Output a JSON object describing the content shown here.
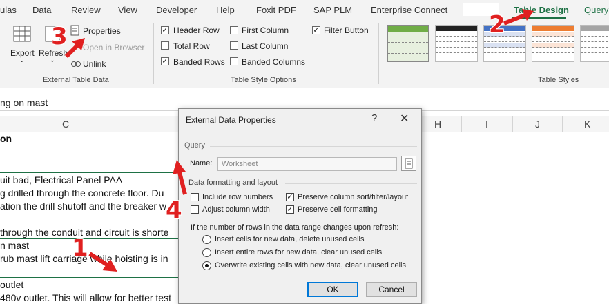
{
  "ribbon_tabs": [
    "ulas",
    "Data",
    "Review",
    "View",
    "Developer",
    "Help",
    "Foxit PDF",
    "SAP PLM",
    "Enterprise Connect",
    "Table Design",
    "Query"
  ],
  "active_tab": "Table Design",
  "external_table_data": {
    "export_label": "Export",
    "refresh_label": "Refresh",
    "properties_label": "Properties",
    "open_in_browser_label": "Open in Browser",
    "unlink_label": "Unlink",
    "group_label": "External Table Data"
  },
  "table_style_options": {
    "header_row": "Header Row",
    "first_column": "First Column",
    "filter_button": "Filter Button",
    "total_row": "Total Row",
    "last_column": "Last Column",
    "banded_rows": "Banded Rows",
    "banded_columns": "Banded Columns",
    "group_label": "Table Style Options",
    "checked": {
      "header_row": true,
      "first_column": false,
      "filter_button": true,
      "total_row": false,
      "last_column": false,
      "banded_rows": true,
      "banded_columns": false
    }
  },
  "table_styles": {
    "group_label": "Table Styles",
    "swatch_colors": [
      "#70ad47",
      "#222222",
      "#4472c4",
      "#ed7d31",
      "#a5a5a5"
    ]
  },
  "formula_bar": {
    "text": "ng on mast"
  },
  "columns": {
    "c": "C",
    "h": "H",
    "i": "I",
    "j": "J",
    "k": "K"
  },
  "sheet_rows": [
    "on",
    "uit bad, Electrical Panel PAA",
    "g drilled through the concrete floor.  Du",
    "ation the drill shutoff and the breaker w",
    "through the conduit and circuit is shorte",
    "n mast",
    "rub mast lift carriage while hoisting is in",
    "outlet",
    "480v outlet. This will allow for better test"
  ],
  "dialog": {
    "title": "External Data Properties",
    "help": "?",
    "close": "✕",
    "query_section": "Query",
    "name_label": "Name:",
    "name_value": "Worksheet",
    "format_section": "Data formatting and layout",
    "include_row_numbers": "Include row numbers",
    "preserve_sort": "Preserve column sort/filter/layout",
    "adjust_column_width": "Adjust column width",
    "preserve_cell_formatting": "Preserve cell formatting",
    "checked": {
      "include_row_numbers": false,
      "preserve_sort": true,
      "adjust_column_width": false,
      "preserve_cell_formatting": true
    },
    "refresh_prompt": "If the number of rows in the data range changes upon refresh:",
    "radio_options": [
      "Insert cells for new data, delete unused cells",
      "Insert entire rows for new data, clear unused cells",
      "Overwrite existing cells with new data, clear unused cells"
    ],
    "selected_radio": 2,
    "ok": "OK",
    "cancel": "Cancel"
  },
  "callouts": [
    "1",
    "2",
    "3",
    "4"
  ],
  "callout_color": "#e02020",
  "accent_color": "#1e7145"
}
